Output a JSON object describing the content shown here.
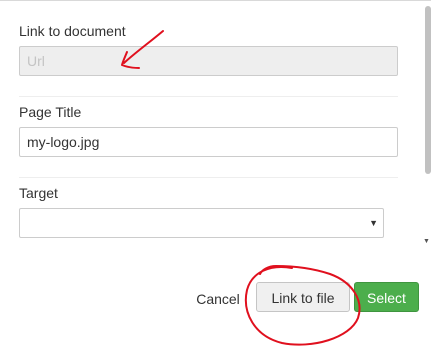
{
  "form": {
    "link_label": "Link to document",
    "url_placeholder": "Url",
    "url_value": "",
    "title_label": "Page Title",
    "title_value": "my-logo.jpg",
    "target_label": "Target",
    "target_value": ""
  },
  "footer": {
    "cancel_label": "Cancel",
    "link_to_file_label": "Link to file",
    "select_label": "Select"
  },
  "colors": {
    "select_button": "#4cae4c",
    "annotation_ink": "#e0101e"
  },
  "icons": {
    "dropdown_arrow": "chevron-down-icon",
    "scroll_arrow": "scroll-down-arrow-icon"
  }
}
